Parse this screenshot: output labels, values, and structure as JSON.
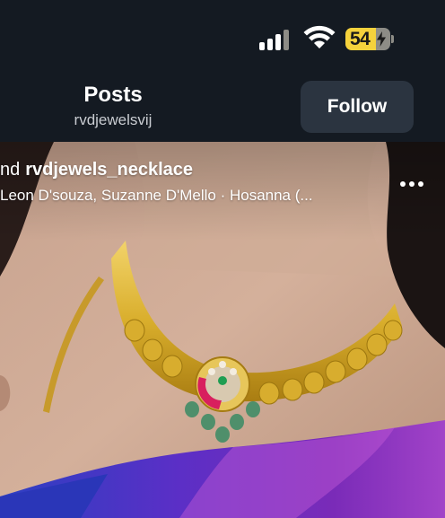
{
  "status_bar": {
    "battery_level": "54",
    "icons": [
      "cellular-signal-icon",
      "wifi-icon",
      "battery-charging-icon"
    ]
  },
  "header": {
    "title": "Posts",
    "username": "rvdjewelsvij",
    "follow_label": "Follow"
  },
  "post": {
    "caption_prefix": "nd",
    "caption_account": "rvdjewels_necklace",
    "audio": "Leon D'souza, Suzanne D'Mello · Hosanna (...",
    "more_icon": "more-options-icon",
    "image_subject": "gold-necklace-photo"
  },
  "colors": {
    "background": "#141a22",
    "follow_button": "#2b3440",
    "battery_fill": "#f5d23c",
    "saree_purple": "#7a2bb8",
    "saree_blue": "#2c3fc2",
    "gold": "#d9ae2c"
  }
}
